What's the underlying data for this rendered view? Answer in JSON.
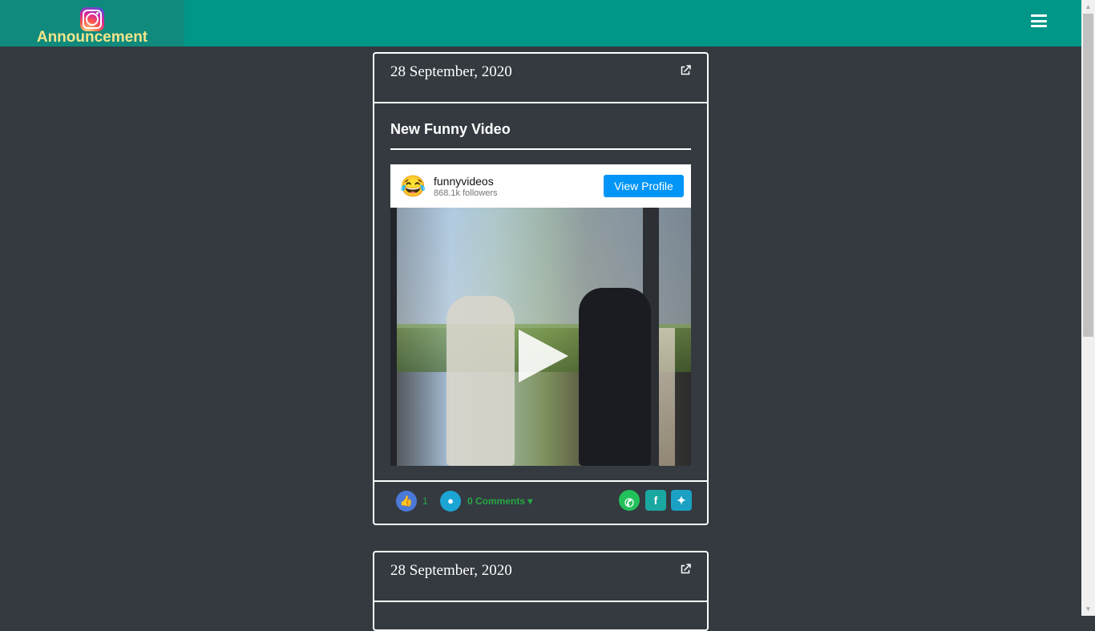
{
  "header": {
    "brand_label": "Announcement",
    "logo_icon": "instagram-icon",
    "menu_icon": "hamburger-menu-icon",
    "colors": {
      "topbar": "#009688",
      "logo_bg": "#0f8a7c",
      "brand_text": "#f2e58a"
    }
  },
  "posts": [
    {
      "date": "28 September, 2020",
      "title": "New Funny Video",
      "embed": {
        "username": "funnyvideos",
        "followers": "868.1k followers",
        "profile_button": "View Profile"
      },
      "likes": "1",
      "comments_label": "0 Comments",
      "share_icons": [
        "whatsapp-icon",
        "facebook-icon",
        "twitter-icon"
      ]
    },
    {
      "date": "28 September, 2020"
    }
  ]
}
